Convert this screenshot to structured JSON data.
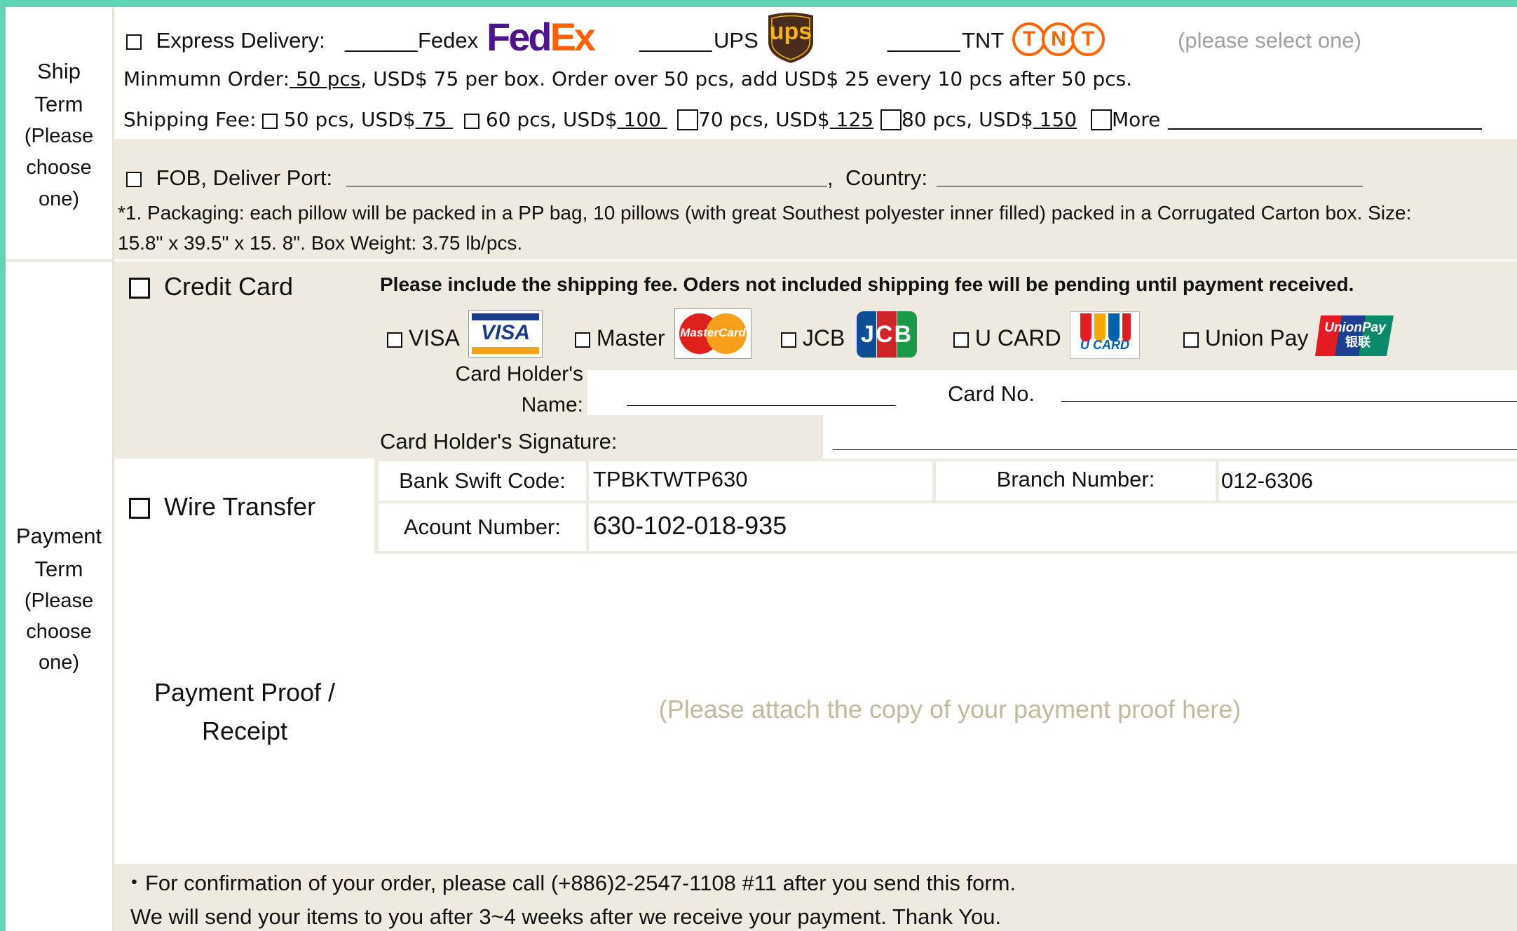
{
  "colors": {
    "frame": "#5fd4b6",
    "beige": "#eeeae0",
    "gray_hint": "#a0a0a0",
    "tan_hint": "#c2b99d",
    "fedex_purple": "#4d148c",
    "fedex_orange": "#ff6200",
    "ups_brown": "#4a2c1a",
    "ups_gold": "#f7b21c",
    "tnt_orange": "#ff6600"
  },
  "ship": {
    "left_label": [
      "Ship",
      "Term",
      "(Please",
      "choose",
      "one)"
    ],
    "express_label": "Express Delivery:",
    "blank_short": "______",
    "fedex_label": "Fedex",
    "fedex_logo": {
      "fed": "Fed",
      "ex": "Ex"
    },
    "ups_label": "UPS",
    "ups_logo": "ups",
    "tnt_label": "TNT",
    "tnt_logo": [
      "T",
      "N",
      "T"
    ],
    "select_hint": "(please select one)",
    "min_order_prefix": "Minmumn Order:",
    "min_order_qty": " 50 pcs",
    "min_order_rest": ", USD$ 75 per box. Order over 50 pcs, add USD$ 25 every 10 pcs after 50 pcs.",
    "shipping_fee_label": "Shipping Fee:",
    "fee_options": [
      {
        "text": "50 pcs, USD$",
        "amount": " 75 "
      },
      {
        "text": "60 pcs, USD$",
        "amount": " 100 "
      },
      {
        "text": "70 pcs, USD$",
        "amount": " 125"
      },
      {
        "text": "80 pcs, USD$",
        "amount": " 150"
      }
    ],
    "more_label": "More",
    "fob_label": "FOB, Deliver Port:",
    "comma": ",",
    "country_label": "Country:",
    "packaging_line1": "*1. Packaging: each pillow will be packed in a PP bag, 10 pillows (with great Southest polyester inner filled) packed in a Corrugated Carton box. Size:",
    "packaging_line2": "15.8\" x  39.5\" x 15. 8\". Box Weight: 3.75 lb/pcs."
  },
  "payment": {
    "left_label": [
      "Payment",
      "Term",
      "(Please",
      "choose",
      "one)"
    ],
    "credit_card_label": "Credit Card",
    "notice": "Please include the shipping fee. Oders not included shipping fee will be pending until payment received.",
    "cards": [
      {
        "label": "VISA",
        "logo_text": "VISA",
        "icon": "visa-logo-icon"
      },
      {
        "label": "Master",
        "logo_text": "MasterCard",
        "icon": "mastercard-logo-icon"
      },
      {
        "label": "JCB",
        "logo_text": "JCB",
        "icon": "jcb-logo-icon"
      },
      {
        "label": "U CARD",
        "logo_text": "U CARD",
        "icon": "ucard-logo-icon"
      },
      {
        "label": "Union Pay",
        "logo_text": "UnionPay",
        "logo_text2": "银联",
        "icon": "unionpay-logo-icon"
      }
    ],
    "holder_name_label_1": "Card Holder's",
    "holder_name_label_2": "Name:",
    "card_no_label": "Card No.",
    "signature_label": "Card Holder's Signature:",
    "wire_label": "Wire Transfer",
    "swift_label": "Bank Swift Code:",
    "swift_value": "TPBKTWTP630",
    "branch_label": "Branch Number:",
    "branch_value": "012-6306",
    "account_label": "Acount Number:",
    "account_value": "630-102-018-935",
    "proof_label_1": "Payment Proof /",
    "proof_label_2": "Receipt",
    "proof_hint": "(Please attach the copy of your payment proof here)"
  },
  "footer": {
    "line1": "・For confirmation of your order, please call (+886)2-2547-1108 #11 after you send this form.",
    "line2": "We will send your items to you after 3~4 weeks after we receive your payment. Thank You."
  }
}
